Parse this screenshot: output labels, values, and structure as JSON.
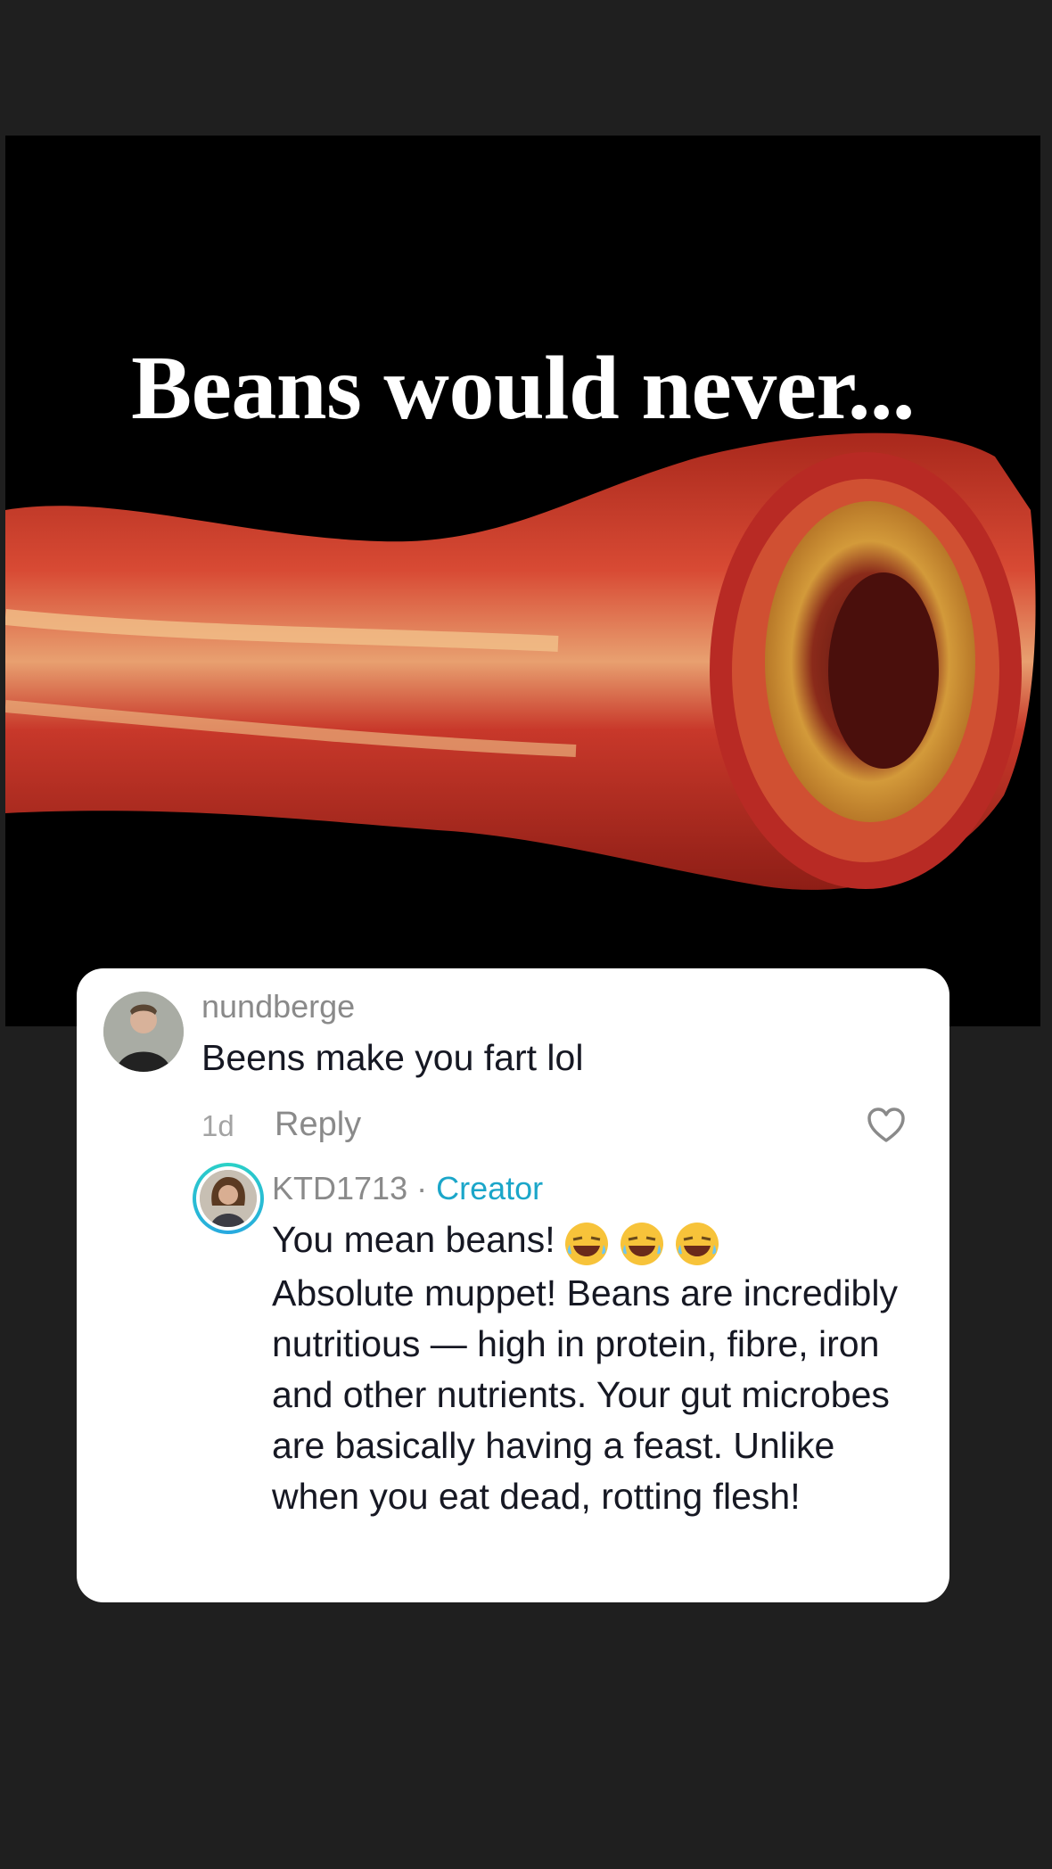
{
  "meme": {
    "title": "Beans would never..."
  },
  "comment": {
    "username": "nundberge",
    "text": "Beens make you fart lol",
    "timestamp": "1d",
    "reply_label": "Reply"
  },
  "reply": {
    "username": "KTD1713",
    "separator": " · ",
    "badge": "Creator",
    "text_lead": "You mean beans!",
    "emoji": [
      "😂",
      "😂",
      "😂"
    ],
    "text_body": "Absolute muppet! Beans are incredibly nutritious — high in protein, fibre, iron and other nutrients. Your gut microbes are basically having a feast. Unlike when you eat dead, rotting flesh!"
  },
  "colors": {
    "background": "#1f1f1f",
    "card": "#ffffff",
    "creator_accent": "#1ba6c9"
  }
}
